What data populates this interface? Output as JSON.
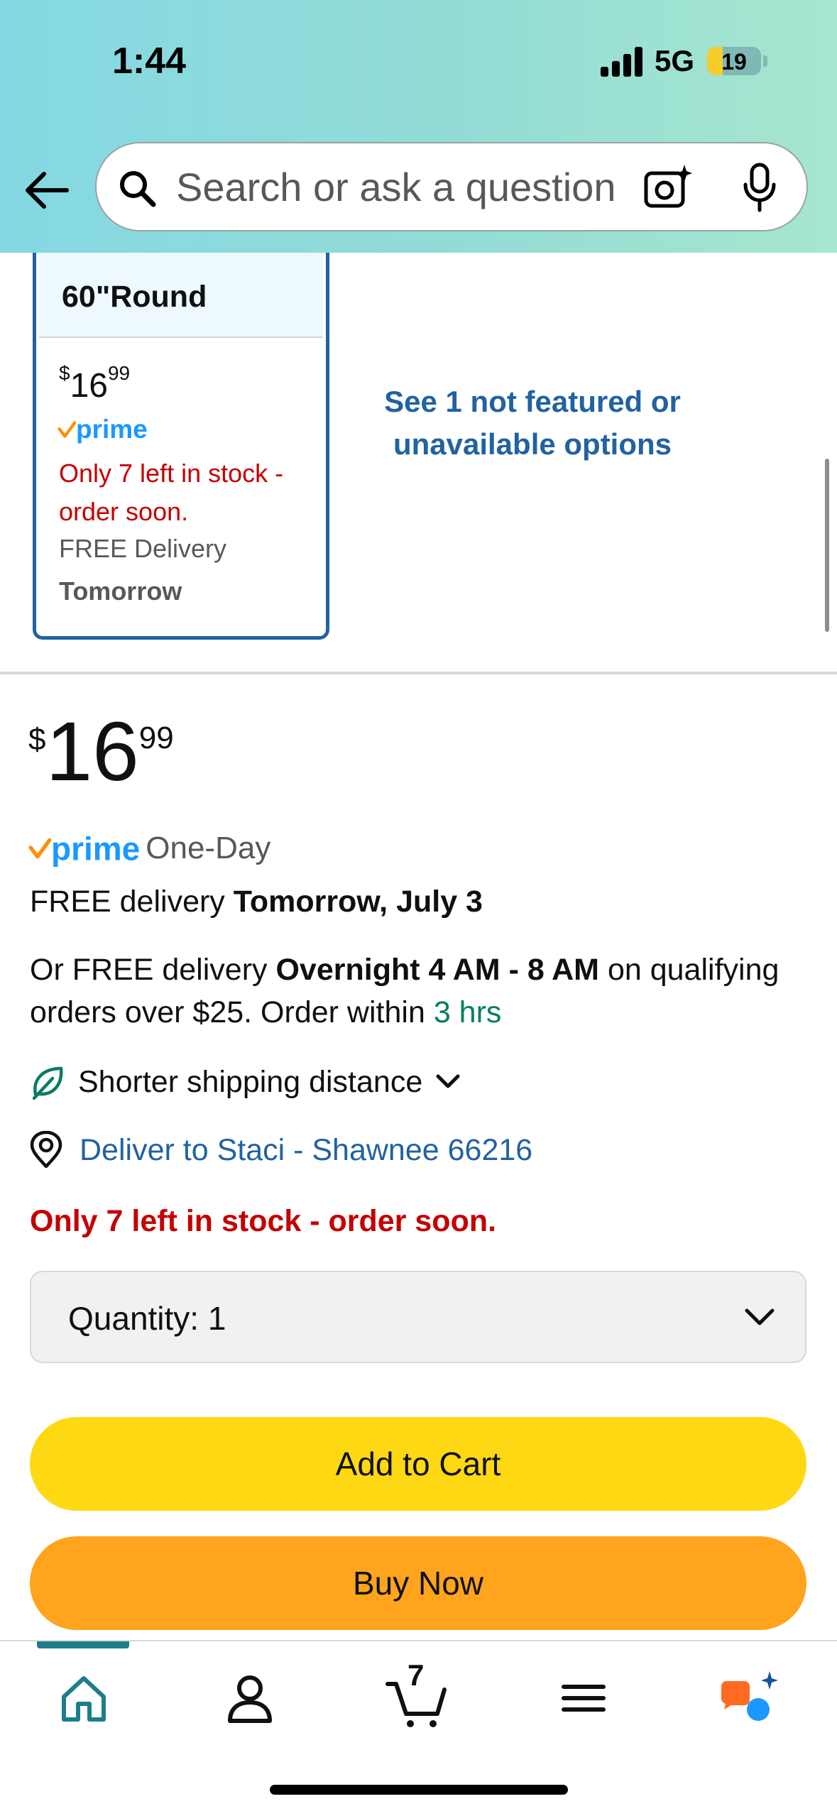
{
  "status_bar": {
    "time": "1:44",
    "network": "5G",
    "battery": "19",
    "battery_level": 0.19
  },
  "search": {
    "placeholder": "Search or ask a question"
  },
  "variant": {
    "name": "60\"Round",
    "price_currency": "$",
    "price_whole": "16",
    "price_fraction": "99",
    "prime_label": "prime",
    "stock_text": "Only 7 left in stock - order soon.",
    "delivery_text": "FREE Delivery",
    "delivery_day": "Tomorrow"
  },
  "see_more": {
    "label": "See 1 not featured or unavailable options"
  },
  "buy_box": {
    "price_currency": "$",
    "price_whole": "16",
    "price_fraction": "99",
    "prime_label": "prime",
    "prime_speed": "One-Day",
    "free_delivery_prefix": "FREE delivery",
    "free_delivery_date": "Tomorrow, July 3",
    "or_free_prefix": "Or FREE delivery",
    "or_free_window": "Overnight 4 AM - 8 AM",
    "or_free_suffix": "on qualifying orders over $25. Order within",
    "order_within": "3 hrs",
    "shorter_shipping": "Shorter shipping distance",
    "deliver_to": "Deliver to Staci - Shawnee 66216",
    "stock_warning": "Only 7 left in stock - order soon.",
    "quantity_label": "Quantity:",
    "quantity_value": "1",
    "add_to_cart": "Add to Cart",
    "buy_now": "Buy Now"
  },
  "bottom_nav": {
    "cart_count": "7",
    "items": [
      "home-icon",
      "account-icon",
      "cart-icon",
      "menu-icon",
      "rufus-ai-icon"
    ]
  },
  "colors": {
    "accent_blue": "#2162a1",
    "prime_blue": "#1a98ff",
    "stock_red": "#c40000",
    "timer_green": "#067d62",
    "add_to_cart_yellow": "#ffd814",
    "buy_now_orange": "#ffa41c",
    "nav_teal": "#1d7e8b"
  }
}
